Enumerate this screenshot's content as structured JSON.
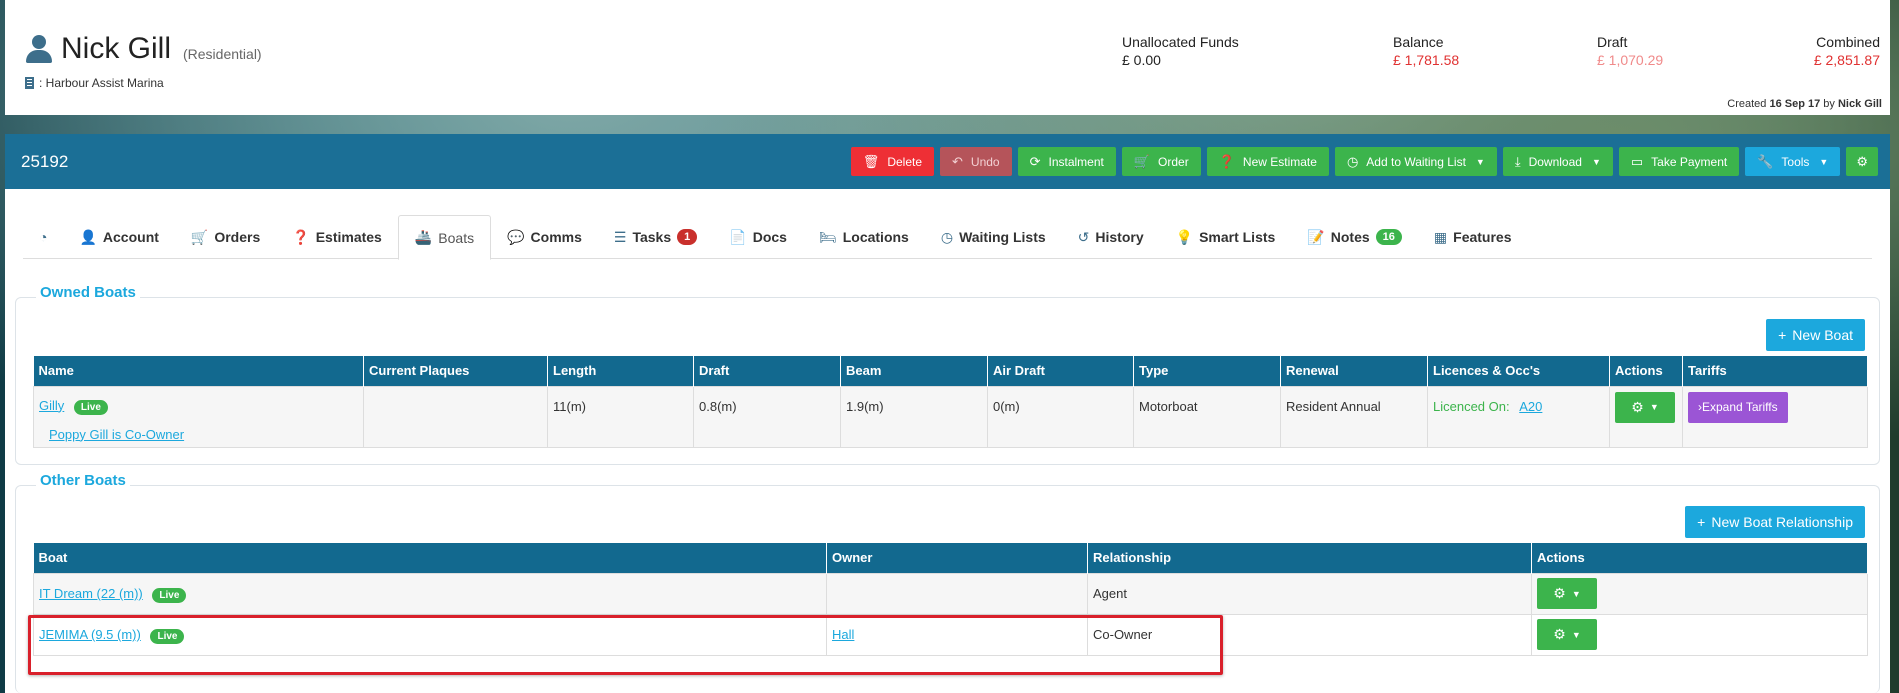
{
  "customer": {
    "name": "Nick Gill",
    "type": "(Residential)",
    "marina": ": Harbour Assist Marina"
  },
  "funds": {
    "unallocated_label": "Unallocated Funds",
    "unallocated_value": "£ 0.00",
    "balance_label": "Balance",
    "balance_value": "£ 1,781.58",
    "draft_label": "Draft",
    "draft_value": "£ 1,070.29",
    "combined_label": "Combined",
    "combined_value": "£ 2,851.87"
  },
  "created": {
    "prefix": "Created",
    "date": "16 Sep 17",
    "by": "by",
    "user": "Nick Gill"
  },
  "toolbar": {
    "id": "25192",
    "delete": "Delete",
    "undo": "Undo",
    "instalment": "Instalment",
    "order": "Order",
    "new_estimate": "New Estimate",
    "add_waiting": "Add to Waiting List",
    "download": "Download",
    "take_payment": "Take Payment",
    "tools": "Tools"
  },
  "tabs": {
    "account": "Account",
    "orders": "Orders",
    "estimates": "Estimates",
    "boats": "Boats",
    "comms": "Comms",
    "tasks": "Tasks",
    "tasks_count": "1",
    "docs": "Docs",
    "locations": "Locations",
    "waiting": "Waiting Lists",
    "history": "History",
    "smart": "Smart Lists",
    "notes": "Notes",
    "notes_count": "16",
    "features": "Features"
  },
  "owned": {
    "title": "Owned Boats",
    "new_boat": "New Boat",
    "headers": [
      "Name",
      "Current Plaques",
      "Length",
      "Draft",
      "Beam",
      "Air Draft",
      "Type",
      "Renewal",
      "Licences & Occ's",
      "Actions",
      "Tariffs"
    ],
    "row": {
      "name": "Gilly",
      "live": "Live",
      "coowner": "Poppy Gill is Co-Owner",
      "plaques": "",
      "length": "11(m)",
      "draft": "0.8(m)",
      "beam": "1.9(m)",
      "air_draft": "0(m)",
      "type": "Motorboat",
      "renewal": "Resident Annual",
      "licenced_on": "Licenced On:",
      "licence": "A20",
      "expand": "Expand Tariffs"
    }
  },
  "other": {
    "title": "Other Boats",
    "new_rel": "New Boat Relationship",
    "headers": [
      "Boat",
      "Owner",
      "Relationship",
      "Actions"
    ],
    "rows": [
      {
        "boat": "IT Dream (22 (m))",
        "live": "Live",
        "owner": "",
        "relationship": "Agent"
      },
      {
        "boat": "JEMIMA (9.5 (m))",
        "live": "Live",
        "owner": "Hall",
        "relationship": "Co-Owner"
      }
    ]
  }
}
